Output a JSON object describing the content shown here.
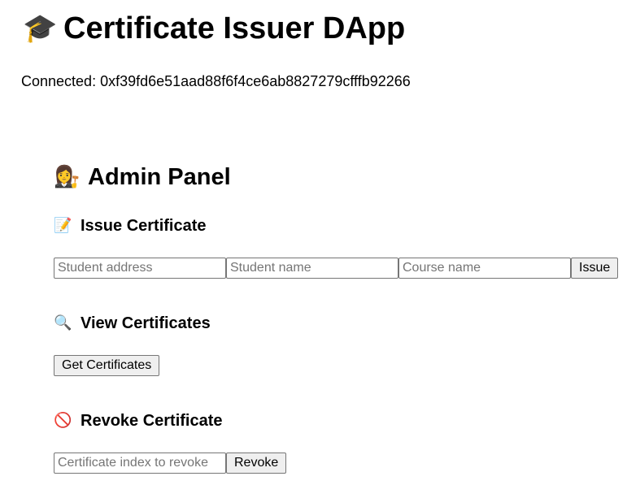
{
  "header": {
    "title": "Certificate Issuer DApp",
    "title_icon": "graduation-cap-icon",
    "connected_label": "Connected: 0xf39fd6e51aad88f6f4ce6ab8827279cfffb92266"
  },
  "admin_panel": {
    "title": "Admin Panel",
    "title_icon": "woman-judge-icon",
    "issue": {
      "title": "Issue Certificate",
      "icon": "memo-icon",
      "student_address_placeholder": "Student address",
      "student_name_placeholder": "Student name",
      "course_name_placeholder": "Course name",
      "button_label": "Issue"
    },
    "view": {
      "title": "View Certificates",
      "icon": "magnifier-icon",
      "button_label": "Get Certificates"
    },
    "revoke": {
      "title": "Revoke Certificate",
      "icon": "prohibited-icon",
      "index_placeholder": "Certificate index to revoke",
      "button_label": "Revoke"
    }
  }
}
